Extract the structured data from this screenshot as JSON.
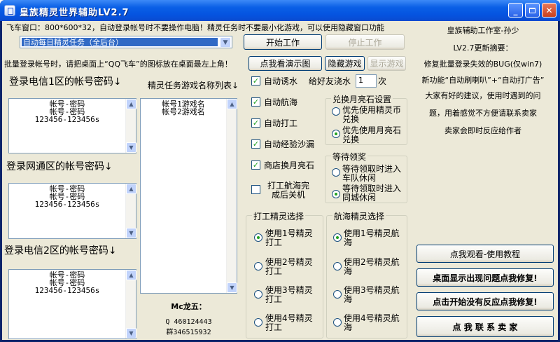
{
  "window": {
    "title": "皇族精灵世界辅助LV2.7"
  },
  "top": {
    "notice": "飞车窗口：800*600*32，自动登录帐号时不要操作电脑！精灵任务时不要最小化游戏，可以使用隐藏窗口功能",
    "combo_value": "自动每日精灵任务（全后台）",
    "start_label": "开始工作",
    "stop_label": "停止工作",
    "batch_text": "批量登录帐号时，请把桌面上“QQ飞车”的图标放在桌面最左上角！",
    "demo_label": "点我看演示图",
    "hide_label": "隐藏游戏",
    "show_label": "显示游戏"
  },
  "accounts": {
    "area1_title": "登录电信1区的帐号密码↓",
    "area2_title": "登录网通区的帐号密码↓",
    "area3_title": "登录电信2区的帐号密码↓",
    "lines": [
      "帐号-密码",
      "帐号-密码",
      "123456-123456s"
    ]
  },
  "spirit": {
    "title": "精灵任务游戏名称列表↓",
    "lines": [
      "帐号1游戏名",
      "帐号2游戏名"
    ],
    "author": "Mc龙五：",
    "qq": "Q 460124443",
    "group": "群346515932"
  },
  "options": {
    "auto_lure": "自动诱水",
    "auto_sail": "自动航海",
    "auto_work": "自动打工",
    "auto_exp": "自动经验沙漏",
    "shop_moon": "商店换月亮石",
    "shutdown": "打工航海完成后关机",
    "friend_water_label": "给好友浇水",
    "friend_water_value": "1",
    "friend_water_unit": "次"
  },
  "exchange": {
    "title": "兑换月亮石设置",
    "opt1": "优先使用精灵币兑换",
    "opt2": "优先使用月亮石兑换"
  },
  "wait": {
    "title": "等待领奖",
    "opt1": "等待领取时进入车队休闲",
    "opt2": "等待领取时进入同城休闲"
  },
  "work_group": {
    "title": "打工精灵选择",
    "items": [
      "使用1号精灵打工",
      "使用2号精灵打工",
      "使用3号精灵打工",
      "使用4号精灵打工"
    ]
  },
  "sail_group": {
    "title": "航海精灵选择",
    "items": [
      "使用1号精灵航海",
      "使用2号精灵航海",
      "使用3号精灵航海",
      "使用4号精灵航海"
    ]
  },
  "info": {
    "studio": "皇族辅助工作室-孙少",
    "update": "LV2.7更新摘要：",
    "fix": "修复批量登录失效的BUG(仅win7)",
    "feature": "新功能“自动刷喇叭”+“自动打广告”",
    "thanks1": "大家有好的建议，使用时遇到的问",
    "thanks2": "题，用着感觉不方便请联系卖家",
    "thanks3": "卖家会即时反应给作者"
  },
  "actions": {
    "tutorial": "点我观看-使用教程",
    "desktop_fix": "桌面显示出现问题点我修复!",
    "start_fix": "点击开始没有反应点我修复!",
    "contact": "点 我 联 系 卖 家"
  }
}
